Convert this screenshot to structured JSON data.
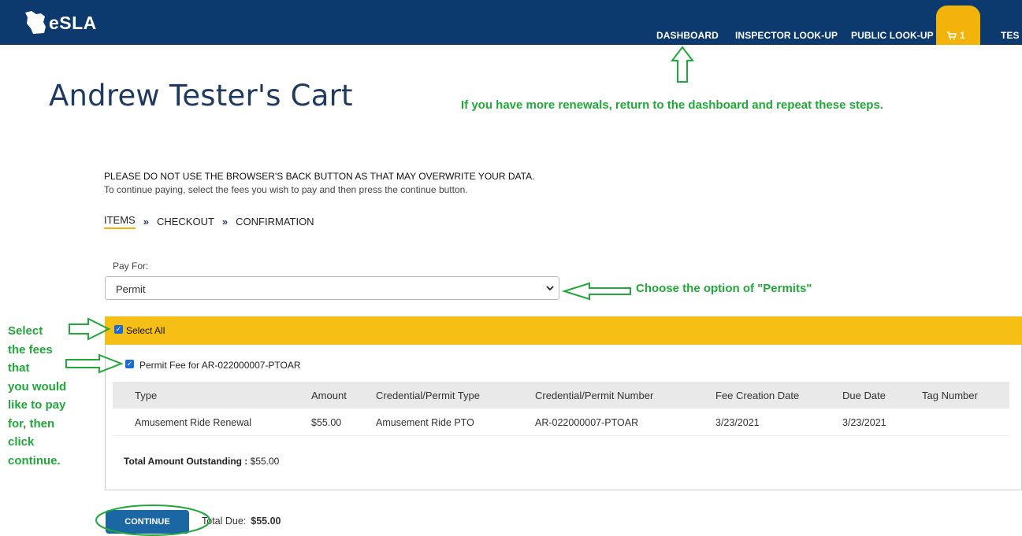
{
  "header": {
    "logo_text": "eSLA",
    "nav": [
      "DASHBOARD",
      "INSPECTOR LOOK-UP",
      "PUBLIC LOOK-UP"
    ],
    "cart_count": "1",
    "partial_nav": "TES",
    "bar_color": "#0c3a6e",
    "cart_color": "#f4b30b"
  },
  "page": {
    "title": "Andrew Tester's Cart",
    "warning": "PLEASE DO NOT USE THE BROWSER'S BACK BUTTON AS THAT MAY OVERWRITE YOUR DATA.",
    "hint": "To continue paying, select the fees you wish to pay and then press the continue button."
  },
  "steps": {
    "items": "ITEMS",
    "checkout": "CHECKOUT",
    "confirmation": "CONFIRMATION",
    "sep": "»"
  },
  "pay_for": {
    "label": "Pay For:",
    "value": "Permit"
  },
  "select_all": "Select All",
  "fee": {
    "label": "Permit Fee for AR-022000007-PTOAR",
    "headers": [
      "Type",
      "Amount",
      "Credential/Permit Type",
      "Credential/Permit Number",
      "Fee Creation Date",
      "Due Date",
      "Tag Number"
    ],
    "row": [
      "Amusement Ride Renewal",
      "$55.00",
      "Amusement Ride PTO",
      "AR-022000007-PTOAR",
      "3/23/2021",
      "3/23/2021",
      ""
    ],
    "total_label": "Total Amount Outstanding :",
    "total_value": "$55.00"
  },
  "footer": {
    "continue": "CONTINUE",
    "total_due_label": "Total Due:",
    "total_due_value": "$55.00"
  },
  "annotations": {
    "top": "If you have more renewals, return to the dashboard and repeat these steps.",
    "permits": "Choose the option of \"Permits\"",
    "left": [
      "Select",
      "the fees",
      "that",
      "you would",
      "like to pay",
      "for, then",
      "click",
      "continue."
    ],
    "color": "#22a83a"
  }
}
